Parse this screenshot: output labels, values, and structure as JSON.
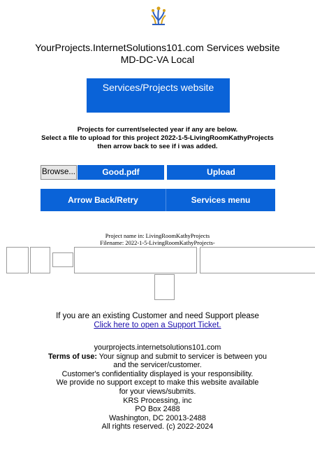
{
  "site": {
    "title_line1": "YourProjects.InternetSolutions101.com Services website",
    "title_line2": "MD-DC-VA Local"
  },
  "nav": {
    "services_button": "Services/Projects website"
  },
  "instructions": {
    "line1": "Projects for current/selected year if any are below.",
    "line2": "Select a file to upload for this project 2022-1-5-LivingRoomKathyProjects",
    "line3": "then arrow back to see if i was added."
  },
  "upload_form": {
    "browse_label": "Browse...",
    "selected_file": "Good.pdf",
    "upload_label": "Upload"
  },
  "actions": {
    "arrow_back_label": "Arrow Back/Retry",
    "services_menu_label": "Services menu"
  },
  "project": {
    "name_line": "Project name in: LivingRoomKathyProjects",
    "filename_line": "Filename: 2022-1-5-LivingRoomKathyProjects-"
  },
  "support": {
    "text": "If you are an existing Customer and need Support please",
    "link_text": "Click here to open a Support Ticket."
  },
  "footer": {
    "domain": "yourprojects.internetsolutions101.com",
    "terms_label": "Terms of use:",
    "terms_text1": " Your signup and submit to servicer is between you",
    "terms_text2": "and the servicer/customer.",
    "confidentiality": "Customer's confidentiality displayed is your responsibility.",
    "support_line1": "We provide no support except to make this website available",
    "support_line2": "for your views/submits.",
    "company": "KRS Processing, inc",
    "po_box": "PO Box 2488",
    "city": "Washington, DC 20013-2488",
    "copyright": "All rights reserved. (c) 2022-2024"
  },
  "colors": {
    "button_blue": "#0a63d8",
    "link_blue": "#1a0dab",
    "logo_gold": "#d8a21a",
    "logo_blue": "#2d5fbf"
  }
}
